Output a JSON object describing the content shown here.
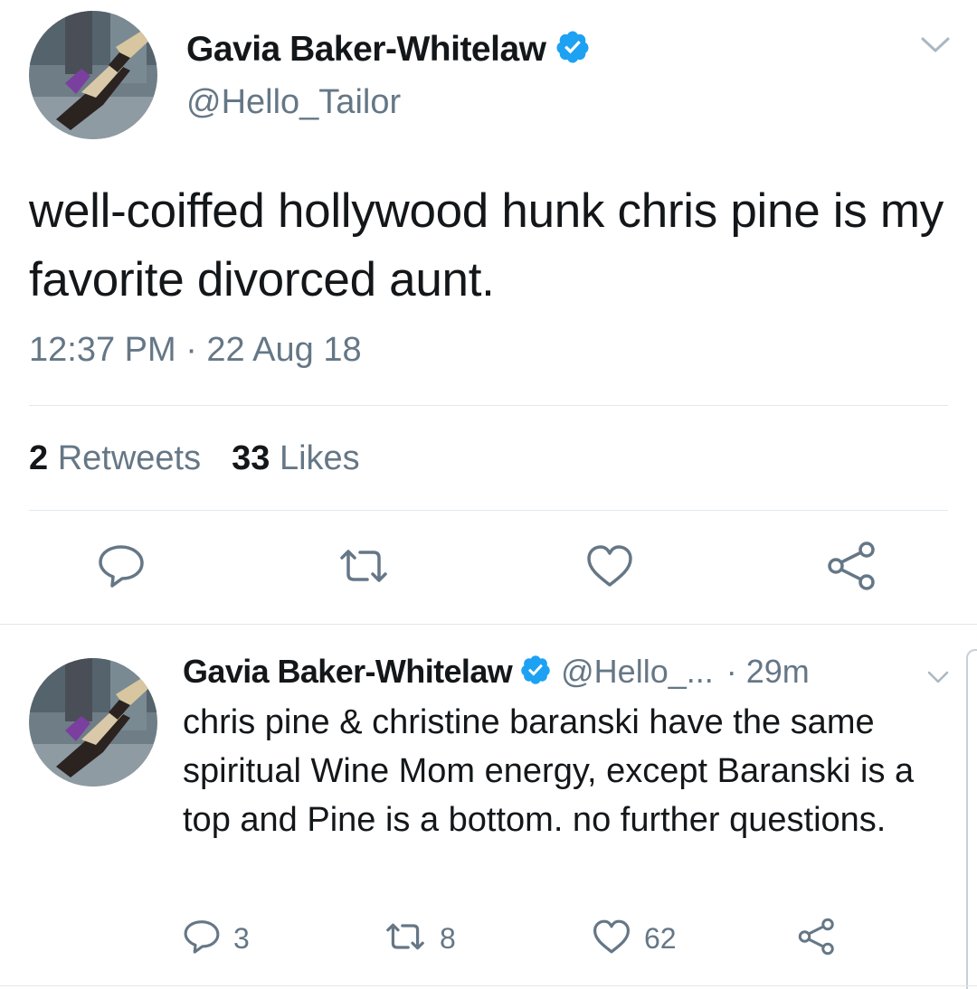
{
  "main_tweet": {
    "author_name": "Gavia Baker-Whitelaw",
    "handle": "@Hello_Tailor",
    "text": "well-coiffed hollywood hunk chris pine is my favorite divorced aunt.",
    "timestamp": "12:37 PM · 22 Aug 18",
    "retweet_count": "2",
    "retweet_label": "Retweets",
    "like_count": "33",
    "like_label": "Likes",
    "icons": {
      "reply": "reply-icon",
      "retweet": "retweet-icon",
      "like": "heart-icon",
      "share": "share-icon",
      "verified": "verified-badge-icon",
      "more": "chevron-down-icon"
    }
  },
  "reply_tweet": {
    "author_name": "Gavia Baker-Whitelaw",
    "handle": "@Hello_...",
    "time_ago": "· 29m",
    "text": "chris pine & christine baranski have the same spiritual Wine Mom energy, except Baranski is a top and Pine is a bottom. no further questions.",
    "reply_count": "3",
    "retweet_count": "8",
    "like_count": "62"
  },
  "colors": {
    "text_primary": "#14171a",
    "text_secondary": "#657786",
    "verified_blue": "#1da1f2",
    "divider": "#e1e8ed",
    "icon_gray": "#657786"
  }
}
